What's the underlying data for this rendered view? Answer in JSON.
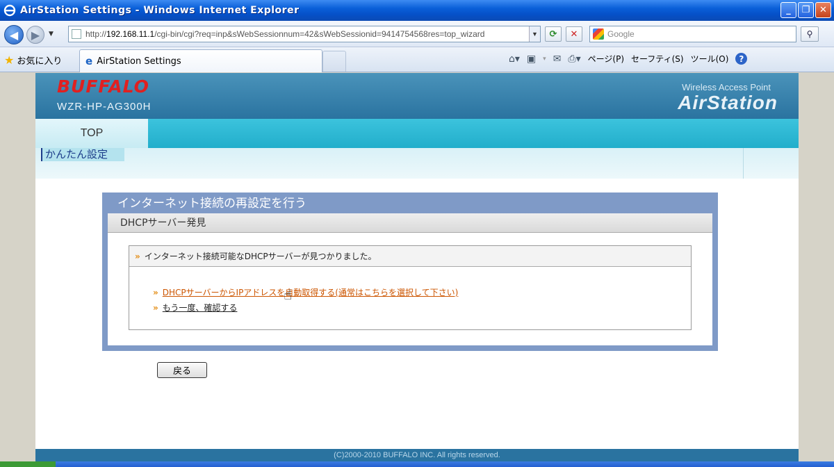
{
  "window": {
    "title": "AirStation Settings - Windows Internet Explorer",
    "minimize": "_",
    "maximize": "❐",
    "close": "✕"
  },
  "address": {
    "prefix": "http://",
    "host": "192.168.11.1",
    "path": "/cgi-bin/cgi?req=inp&sWebSessionnum=42&sWebSessionid=9414754568res=top_wizard"
  },
  "search": {
    "placeholder": "Google"
  },
  "favorites": {
    "label": "お気に入り"
  },
  "tab": {
    "title": "AirStation Settings"
  },
  "command_bar": {
    "page": "ページ(P)",
    "safety": "セーフティ(S)",
    "tools": "ツール(O)"
  },
  "header": {
    "brand": "BUFFALO",
    "model": "WZR-HP-AG300H",
    "product_sub": "Wireless Access Point",
    "product": "AirStation"
  },
  "menu": {
    "top_tab": "TOP",
    "sub_item": "かんたん設定"
  },
  "panel": {
    "title": "インターネット接続の再設定を行う",
    "section": "DHCPサーバー発見",
    "message": "インターネット接続可能なDHCPサーバーが見つかりました。",
    "links": [
      {
        "label": "DHCPサーバーからIPアドレスを自動取得する(通常はこちらを選択して下さい)"
      },
      {
        "label": "もう一度、確認する"
      }
    ]
  },
  "back_button": "戻る",
  "footer": "(C)2000-2010 BUFFALO INC. All rights reserved.",
  "colors": {
    "header_blue": "#2a73a0",
    "menu_cyan": "#21aecb",
    "panel_border": "#7f9ac7",
    "link_orange": "#cc5500",
    "brand_red": "#e02020"
  }
}
